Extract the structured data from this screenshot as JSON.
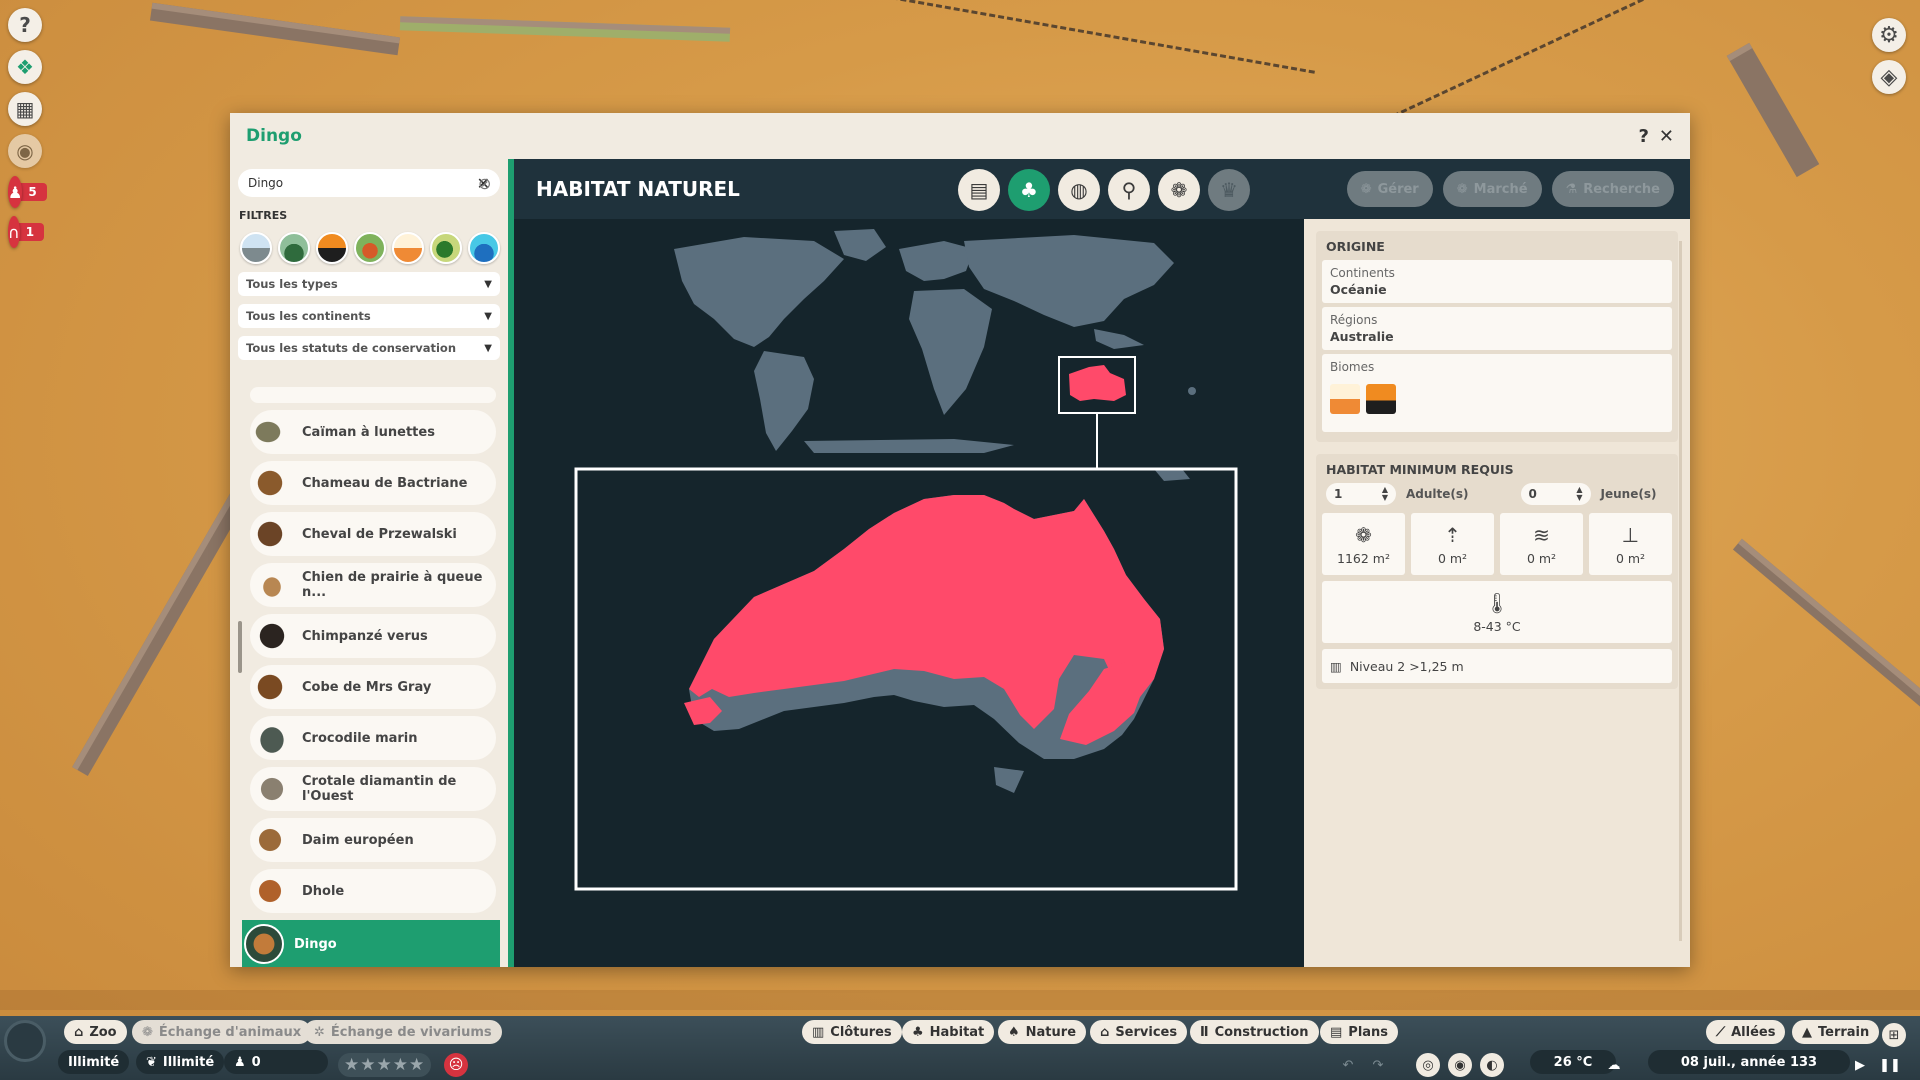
{
  "window": {
    "title": "Dingo",
    "help": "?",
    "close": "✕"
  },
  "sidebar": {
    "search_value": "Dingo",
    "filters_label": "FILTRES",
    "dropdowns": [
      "Tous les types",
      "Tous les continents",
      "Tous les statuts de conservation"
    ],
    "items": [
      {
        "label": "Caïman à lunettes"
      },
      {
        "label": "Chameau de Bactriane"
      },
      {
        "label": "Cheval de Przewalski"
      },
      {
        "label": "Chien de prairie à queue n..."
      },
      {
        "label": "Chimpanzé verus"
      },
      {
        "label": "Cobe de Mrs Gray"
      },
      {
        "label": "Crocodile marin"
      },
      {
        "label": "Crotale diamantin de l'Ouest"
      },
      {
        "label": "Daim européen"
      },
      {
        "label": "Dhole"
      },
      {
        "label": "Dingo"
      }
    ],
    "selected": "Dingo"
  },
  "content": {
    "title": "HABITAT NATUREL",
    "tabs": [
      "clipboard-icon",
      "habitat-icon",
      "drop-icon",
      "enrichment-icon",
      "paw-icon",
      "trophy-icon"
    ],
    "head_buttons": [
      "Gérer",
      "Marché",
      "Recherche"
    ]
  },
  "info": {
    "origin": {
      "title": "ORIGINE",
      "continents_label": "Continents",
      "continents_value": "Océanie",
      "regions_label": "Régions",
      "regions_value": "Australie",
      "biomes_label": "Biomes"
    },
    "habitat": {
      "title": "HABITAT MINIMUM REQUIS",
      "adults_value": "1",
      "adults_label": "Adulte(s)",
      "young_value": "0",
      "young_label": "Jeune(s)",
      "stats": [
        "1162 m²",
        "0 m²",
        "0 m²",
        "0 m²"
      ],
      "temperature": "8-43 °C",
      "fence": "Niveau 2 >1,25 m"
    }
  },
  "bottom": {
    "row1_left": [
      "Zoo",
      "Échange d'animaux",
      "Échange de vivariums"
    ],
    "row1_center": [
      "Clôtures",
      "Habitat",
      "Nature",
      "Services",
      "Construction",
      "Plans"
    ],
    "row1_right": [
      "Allées",
      "Terrain"
    ],
    "money": "Illimité",
    "research": "Illimité",
    "guests": "0",
    "stars": "★★★★★",
    "temperature": "26 °C",
    "date": "08 juil., année 133"
  },
  "hud": {
    "alert1_count": "5",
    "alert2_count": "1"
  }
}
